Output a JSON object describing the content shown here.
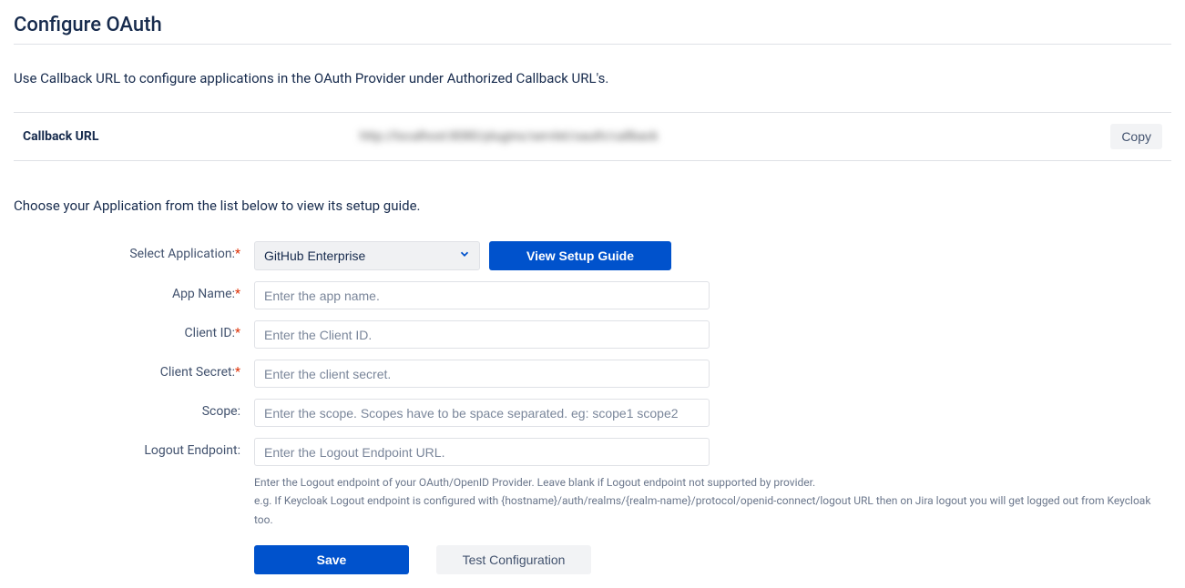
{
  "page": {
    "title": "Configure OAuth",
    "intro": "Use Callback URL to configure applications in the OAuth Provider under Authorized Callback URL's."
  },
  "callback": {
    "label": "Callback URL",
    "url_display": "http://localhost:8080/plugins/servlet/oauth/callback",
    "copy_label": "Copy"
  },
  "choose_text": "Choose your Application from the list below to view its setup guide.",
  "form": {
    "select_app": {
      "label": "Select Application:",
      "value": "GitHub Enterprise"
    },
    "setup_guide_label": "View Setup Guide",
    "app_name": {
      "label": "App Name:",
      "placeholder": "Enter the app name.",
      "value": ""
    },
    "client_id": {
      "label": "Client ID:",
      "placeholder": "Enter the Client ID.",
      "value": ""
    },
    "client_secret": {
      "label": "Client Secret:",
      "placeholder": "Enter the client secret.",
      "value": ""
    },
    "scope": {
      "label": "Scope:",
      "placeholder": "Enter the scope. Scopes have to be space separated. eg: scope1 scope2",
      "value": ""
    },
    "logout_endpoint": {
      "label": "Logout Endpoint:",
      "placeholder": "Enter the Logout Endpoint URL.",
      "value": ""
    },
    "logout_hint1": "Enter the Logout endpoint of your OAuth/OpenID Provider. Leave blank if Logout endpoint not supported by provider.",
    "logout_hint2": "e.g. If Keycloak Logout endpoint is configured with {hostname}/auth/realms/{realm-name}/protocol/openid-connect/logout URL then on Jira logout you will get logged out from Keycloak too."
  },
  "buttons": {
    "save": "Save",
    "test": "Test Configuration"
  }
}
